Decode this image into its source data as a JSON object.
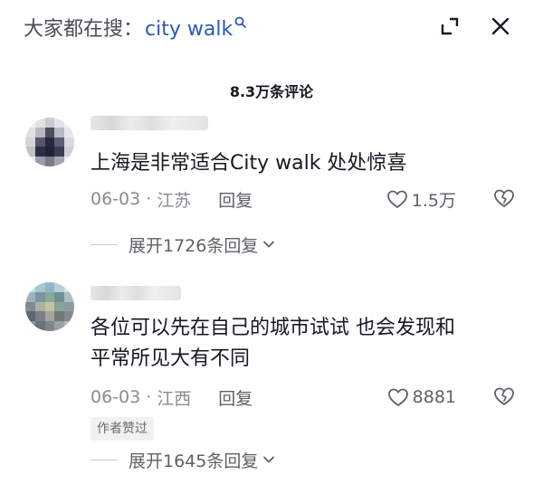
{
  "header": {
    "search_prefix": "大家都在搜：",
    "search_keyword": "city walk",
    "comment_count": "8.3万条评论"
  },
  "icons": {
    "search": "search-icon",
    "expand": "expand-icon",
    "close": "close-icon",
    "like": "heart-icon",
    "dislike": "broken-heart-icon",
    "chevron": "chevron-down-icon"
  },
  "colors": {
    "keyword": "#2a59b8",
    "text": "#161823",
    "meta": "#8a8b91"
  },
  "comments": [
    {
      "text": "上海是非常适合City walk 处处惊喜",
      "date": "06-03",
      "location": "江苏",
      "reply_label": "回复",
      "likes": "1.5万",
      "expand_label": "展开1726条回复"
    },
    {
      "text_line1": "各位可以先在自己的城市试试 也会发现和",
      "text_line2": "平常所见大有不同",
      "date": "06-03",
      "location": "江西",
      "reply_label": "回复",
      "likes": "8881",
      "badge": "作者赞过",
      "expand_label": "展开1645条回复"
    }
  ]
}
